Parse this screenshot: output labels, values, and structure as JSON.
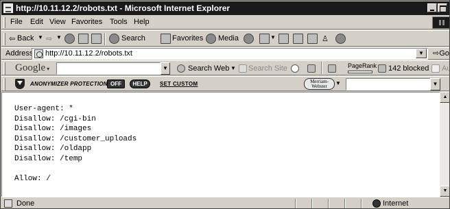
{
  "window": {
    "title": "http://10.11.12.2/robots.txt - Microsoft Internet Explorer"
  },
  "menu": [
    "File",
    "Edit",
    "View",
    "Favorites",
    "Tools",
    "Help"
  ],
  "toolbar": {
    "back": "Back",
    "search": "Search",
    "favorites": "Favorites",
    "media": "Media"
  },
  "address": {
    "label": "Address",
    "url": "http://10.11.12.2/robots.txt",
    "go": "Go"
  },
  "google": {
    "logo": "Google",
    "search_web": "Search Web",
    "search_site": "Search Site",
    "pagerank": "PageRank",
    "blocked": "142 blocked",
    "autofill": "Au"
  },
  "anonymizer": {
    "label": "ANONYMIZER PROTECTION IS:",
    "state": "OFF",
    "help": "HELP",
    "set_custom": "SET CUSTOM",
    "dictionary_logo": "Merriam-Webster"
  },
  "content": {
    "text": "User-agent: *\nDisallow: /cgi-bin\nDisallow: /images\nDisallow: /customer_uploads\nDisallow: /oldapp\nDisallow: /temp\n\nAllow: /"
  },
  "status": {
    "text": "Done",
    "zone": "Internet"
  }
}
